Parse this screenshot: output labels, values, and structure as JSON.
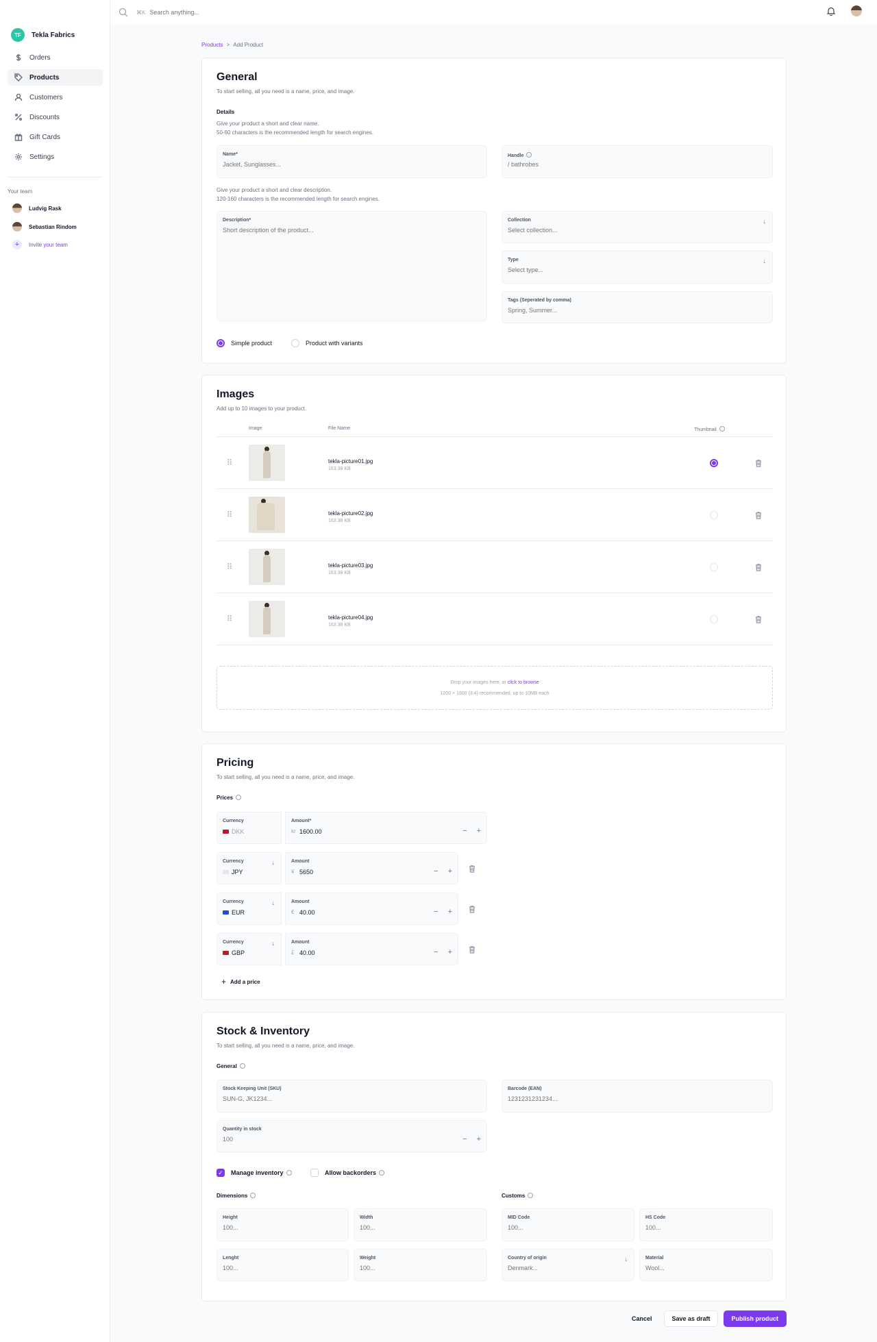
{
  "store": {
    "initials": "TF",
    "name": "Tekla Fabrics"
  },
  "nav": [
    {
      "label": "Orders",
      "icon": "dollar-icon",
      "active": false
    },
    {
      "label": "Products",
      "icon": "tag-icon",
      "active": true
    },
    {
      "label": "Customers",
      "icon": "user-icon",
      "active": false
    },
    {
      "label": "Discounts",
      "icon": "percent-icon",
      "active": false
    },
    {
      "label": "Gift Cards",
      "icon": "gift-icon",
      "active": false
    },
    {
      "label": "Settings",
      "icon": "gear-icon",
      "active": false
    }
  ],
  "team": {
    "heading": "Your team",
    "members": [
      "Ludvig Rask",
      "Sebastian Rindom"
    ],
    "invite_label": "Invite your team"
  },
  "topbar": {
    "shortcut": "⌘K",
    "search_placeholder": "Search anything..."
  },
  "breadcrumb": {
    "parent": "Products",
    "separator": ">",
    "current": "Add Product"
  },
  "general": {
    "title": "General",
    "subtitle": "To start selling, all you need is a name, price, and image.",
    "details_label": "Details",
    "name_hint_1": "Give your product a short and clear name.",
    "name_hint_2": "50-60 characters is the recommended length for search engines.",
    "name_label": "Name*",
    "name_placeholder": "Jacket, Sunglasses...",
    "handle_label": "Handle",
    "handle_placeholder": "/ bathrobes",
    "desc_hint_1": "Give your product a short and clear description.",
    "desc_hint_2": "120-160 characters is the recommended length for search engines.",
    "description_label": "Description*",
    "description_placeholder": "Short description of the product...",
    "collection_label": "Collection",
    "collection_placeholder": "Select collection...",
    "type_label": "Type",
    "type_placeholder": "Select type...",
    "tags_label": "Tags (Seperated by comma)",
    "tags_placeholder": "Spring, Summer...",
    "option_simple": "Simple product",
    "option_variants": "Product with variants",
    "selected_option": "simple"
  },
  "images": {
    "title": "Images",
    "subtitle": "Add up to 10 images to your product.",
    "col_image": "Image",
    "col_file": "File Name",
    "col_thumbnail": "Thumbnail",
    "rows": [
      {
        "file": "tekla-picture01.jpg",
        "size": "163.38 KB",
        "thumbnail": true
      },
      {
        "file": "tekla-picture02.jpg",
        "size": "163.38 KB",
        "thumbnail": false
      },
      {
        "file": "tekla-picture03.jpg",
        "size": "163.38 KB",
        "thumbnail": false
      },
      {
        "file": "tekla-picture04.jpg",
        "size": "163.38 KB",
        "thumbnail": false
      }
    ],
    "drop_text": "Drop your images here, or",
    "drop_link": "click to browse",
    "drop_hint": "1200 × 1600 (3:4) recommended, up to 10MB each"
  },
  "pricing": {
    "title": "Pricing",
    "subtitle": "To start selling, all you need is a name, price, and image.",
    "prices_label": "Prices",
    "currency_label": "Currency",
    "rows": [
      {
        "currency": "DKK",
        "symbol": "kr",
        "amount_label": "Amount*",
        "amount": "1600.00",
        "flag": "#c8102e",
        "default": true
      },
      {
        "currency": "JPY",
        "symbol": "¥",
        "amount_label": "Amount",
        "amount": "5650",
        "flag": "#e5e7eb",
        "default": false
      },
      {
        "currency": "EUR",
        "symbol": "€",
        "amount_label": "Amount",
        "amount": "40.00",
        "flag": "#1d4ed8",
        "default": false
      },
      {
        "currency": "GBP",
        "symbol": "£",
        "amount_label": "Amount",
        "amount": "40.00",
        "flag": "#b91c1c",
        "default": false
      }
    ],
    "add_price": "Add a price"
  },
  "stock": {
    "title": "Stock & Inventory",
    "subtitle": "To start selling, all you need is a name, price, and image.",
    "general_label": "General",
    "sku_label": "Stock Keeping Unit (SKU)",
    "sku_placeholder": "SUN-G, JK1234...",
    "barcode_label": "Barcode (EAN)",
    "barcode_placeholder": "1231231231234...",
    "qty_label": "Quantity in stock",
    "qty_placeholder": "100",
    "manage_inventory": "Manage inventory",
    "manage_inventory_checked": true,
    "allow_backorders": "Allow backorders",
    "allow_backorders_checked": false,
    "dimensions_label": "Dimensions",
    "customs_label": "Customs",
    "height_label": "Height",
    "height_placeholder": "100...",
    "width_label": "Width",
    "width_placeholder": "100...",
    "length_label": "Lenght",
    "length_placeholder": "100...",
    "weight_label": "Weight",
    "weight_placeholder": "100...",
    "mid_label": "MID Code",
    "mid_placeholder": "100...",
    "hs_label": "HS Code",
    "hs_placeholder": "100...",
    "country_label": "Country of origin",
    "country_placeholder": "Denmark...",
    "material_label": "Material",
    "material_placeholder": "Wool..."
  },
  "actions": {
    "cancel": "Cancel",
    "draft": "Save as draft",
    "publish": "Publish product"
  },
  "colors": {
    "accent": "#7c3aed",
    "store_avatar": "#2cc6a6"
  }
}
